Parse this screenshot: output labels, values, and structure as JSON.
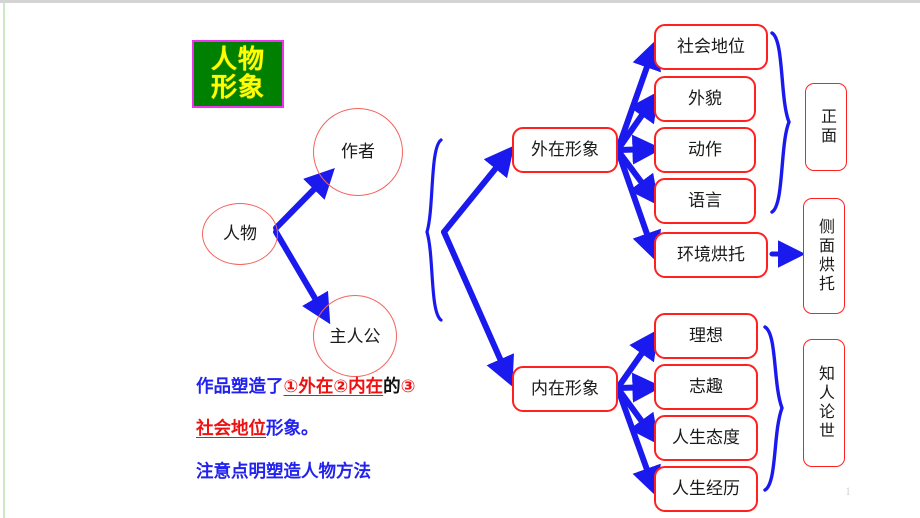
{
  "slide": {
    "title_lines": [
      "人物",
      "形象"
    ],
    "page_number": "1",
    "colors": {
      "title_bg": "#008000",
      "title_border": "#ee33ee",
      "title_text": "#ffff00",
      "circle_border": "#f4635f",
      "box_border": "#ff2020",
      "connector": "#1a1aee",
      "note_blue": "#2222ee",
      "note_red": "#ee1111",
      "edge_green": "#cfe8c4",
      "top_rule": "#d4d4d4"
    }
  },
  "nodes": {
    "root": "人物",
    "branch_author": "作者",
    "branch_protagonist": "主人公",
    "outer_image": "外在形象",
    "inner_image": "内在形象"
  },
  "outer_items": [
    {
      "label": "社会地位"
    },
    {
      "label": "外貌"
    },
    {
      "label": "动作"
    },
    {
      "label": "语言"
    },
    {
      "label": "环境烘托"
    }
  ],
  "inner_items": [
    {
      "label": "理想"
    },
    {
      "label": "志趣"
    },
    {
      "label": "人生态度"
    },
    {
      "label": "人生经历"
    }
  ],
  "summaries": {
    "front": "正面",
    "side": "侧面烘托",
    "know_person": "知人论世"
  },
  "note": {
    "line1": [
      {
        "text": "作品塑造了",
        "style": "blue"
      },
      {
        "text": "①外在②内在",
        "style": "red-underline"
      },
      {
        "text": "的",
        "style": "black"
      },
      {
        "text": "③",
        "style": "red"
      }
    ],
    "line2": [
      {
        "text": "社会地位",
        "style": "red-underline"
      },
      {
        "text": "形象。",
        "style": "blue"
      }
    ],
    "line3": [
      {
        "text": "注意点明塑造人物方法",
        "style": "blue"
      }
    ]
  }
}
